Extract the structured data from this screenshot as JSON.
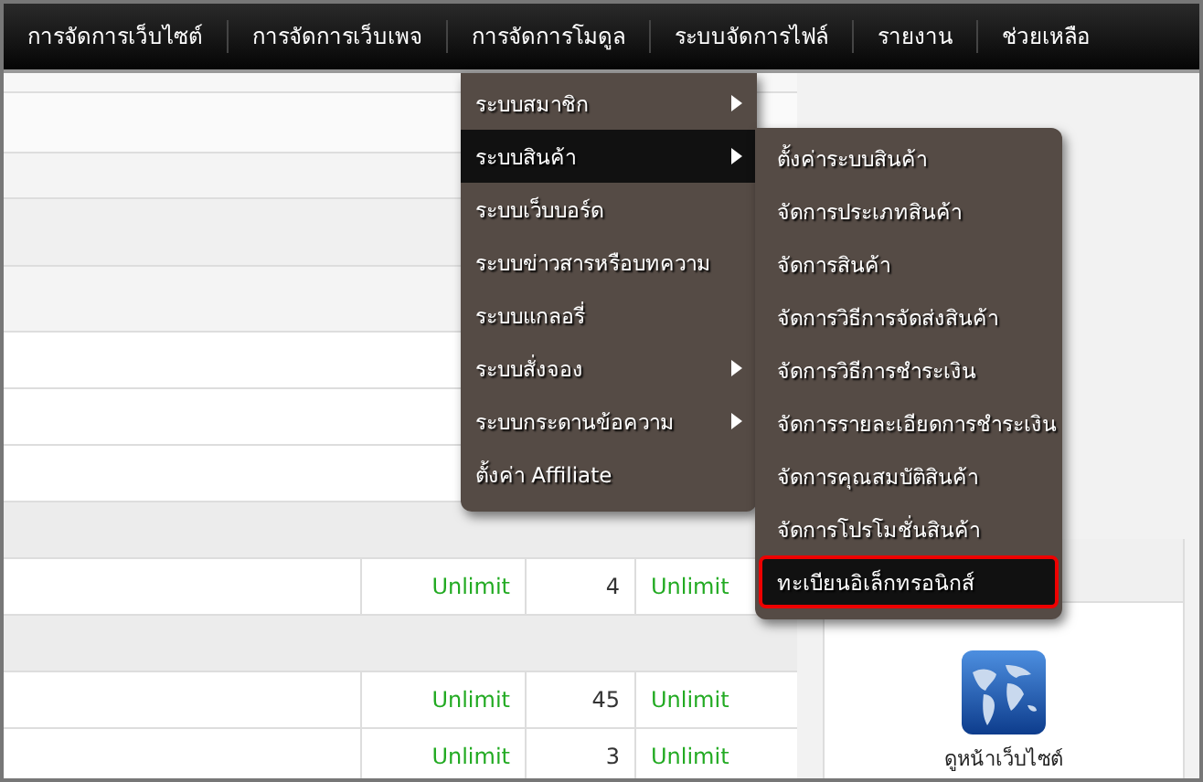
{
  "nav": {
    "items": [
      "การจัดการเว็บไซต์",
      "การจัดการเว็บเพจ",
      "การจัดการโมดูล",
      "ระบบจัดการไฟล์",
      "รายงาน",
      "ช่วยเหลือ"
    ]
  },
  "table": {
    "rows": [
      {
        "kind": "blank"
      },
      {
        "kind": "blank"
      },
      {
        "kind": "blank"
      },
      {
        "kind": "section"
      },
      {
        "kind": "data",
        "quota": "Unlimit",
        "used": "4",
        "remaining": "Unlimit"
      },
      {
        "kind": "section"
      },
      {
        "kind": "data",
        "quota": "Unlimit",
        "used": "45",
        "remaining": "Unlimit"
      },
      {
        "kind": "data",
        "quota": "Unlimit",
        "used": "3",
        "remaining": "Unlimit"
      }
    ]
  },
  "side_panel": {
    "shortcut": "ดูหน้าเว็บไซต์"
  },
  "dropdown": {
    "items": [
      {
        "label": "ระบบสมาชิก",
        "selected": false,
        "has_submenu": true
      },
      {
        "label": "ระบบสินค้า",
        "selected": true,
        "has_submenu": true
      },
      {
        "label": "ระบบเว็บบอร์ด",
        "selected": false,
        "has_submenu": false
      },
      {
        "label": "ระบบข่าวสารหรือบทความ",
        "selected": false,
        "has_submenu": false
      },
      {
        "label": "ระบบแกลอรี่",
        "selected": false,
        "has_submenu": false
      },
      {
        "label": "ระบบสั่งจอง",
        "selected": false,
        "has_submenu": true
      },
      {
        "label": "ระบบกระดานข้อความ",
        "selected": false,
        "has_submenu": true
      },
      {
        "label": "ตั้งค่า Affiliate",
        "selected": false,
        "has_submenu": false
      }
    ]
  },
  "submenu": {
    "items": [
      {
        "label": "ตั้งค่าระบบสินค้า",
        "selected": false
      },
      {
        "label": "จัดการประเภทสินค้า",
        "selected": false
      },
      {
        "label": "จัดการสินค้า",
        "selected": false
      },
      {
        "label": "จัดการวิธีการจัดส่งสินค้า",
        "selected": false
      },
      {
        "label": "จัดการวิธีการชำระเงิน",
        "selected": false
      },
      {
        "label": "จัดการรายละเอียดการชำระเงิน",
        "selected": false
      },
      {
        "label": "จัดการคุณสมบัติสินค้า",
        "selected": false
      },
      {
        "label": "จัดการโปรโมชั่นสินค้า",
        "selected": false
      },
      {
        "label": "ทะเบียนอิเล็กทรอนิกส์",
        "selected": true
      }
    ]
  }
}
